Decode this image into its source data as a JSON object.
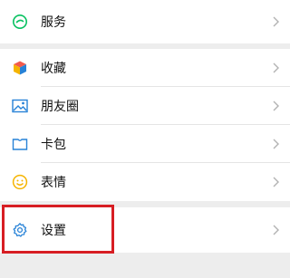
{
  "menu": {
    "services": {
      "label": "服务",
      "icon": "services-icon",
      "color": "#07c160"
    },
    "favorites": {
      "label": "收藏",
      "icon": "favorites-cube-icon"
    },
    "moments": {
      "label": "朋友圈",
      "icon": "moments-image-icon",
      "color": "#2782d7"
    },
    "cards": {
      "label": "卡包",
      "icon": "card-wallet-icon",
      "color": "#2782d7"
    },
    "stickers": {
      "label": "表情",
      "icon": "sticker-face-icon",
      "color": "#f5b400"
    },
    "settings": {
      "label": "设置",
      "icon": "gear-icon",
      "color": "#2782d7"
    }
  },
  "colors": {
    "background": "#ededed",
    "row": "#ffffff",
    "highlight_border": "#d71e23",
    "chevron": "#b2b2b2"
  }
}
